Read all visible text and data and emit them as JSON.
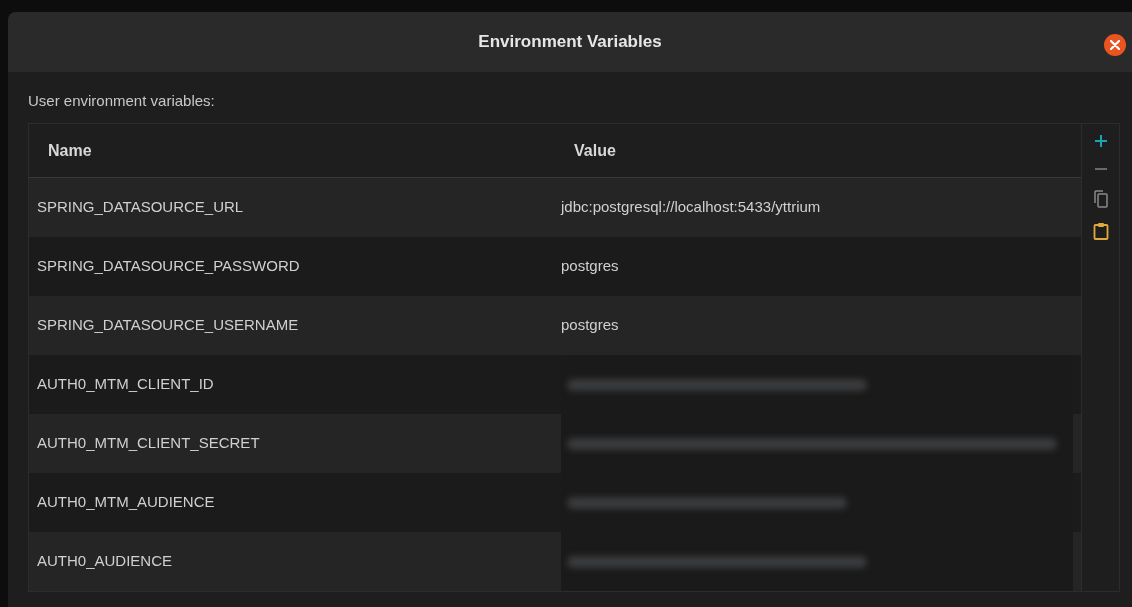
{
  "window": {
    "title": "Environment Variables"
  },
  "section_label": "User environment variables:",
  "table": {
    "columns": [
      "Name",
      "Value"
    ],
    "rows": [
      {
        "name": "SPRING_DATASOURCE_URL",
        "value": {
          "kind": "text",
          "text": "jdbc:postgresql://localhost:5433/yttrium"
        }
      },
      {
        "name": "SPRING_DATASOURCE_PASSWORD",
        "value": {
          "kind": "text",
          "text": "postgres"
        }
      },
      {
        "name": "SPRING_DATASOURCE_USERNAME",
        "value": {
          "kind": "text",
          "text": "postgres"
        }
      },
      {
        "name": "AUTH0_MTM_CLIENT_ID",
        "value": {
          "kind": "redacted",
          "level": 0.6
        }
      },
      {
        "name": "AUTH0_MTM_CLIENT_SECRET",
        "value": {
          "kind": "redacted",
          "level": 0.98
        }
      },
      {
        "name": "AUTH0_MTM_AUDIENCE",
        "value": {
          "kind": "redacted",
          "level": 0.56
        }
      },
      {
        "name": "AUTH0_AUDIENCE",
        "value": {
          "kind": "redacted",
          "level": 0.6
        }
      }
    ]
  }
}
